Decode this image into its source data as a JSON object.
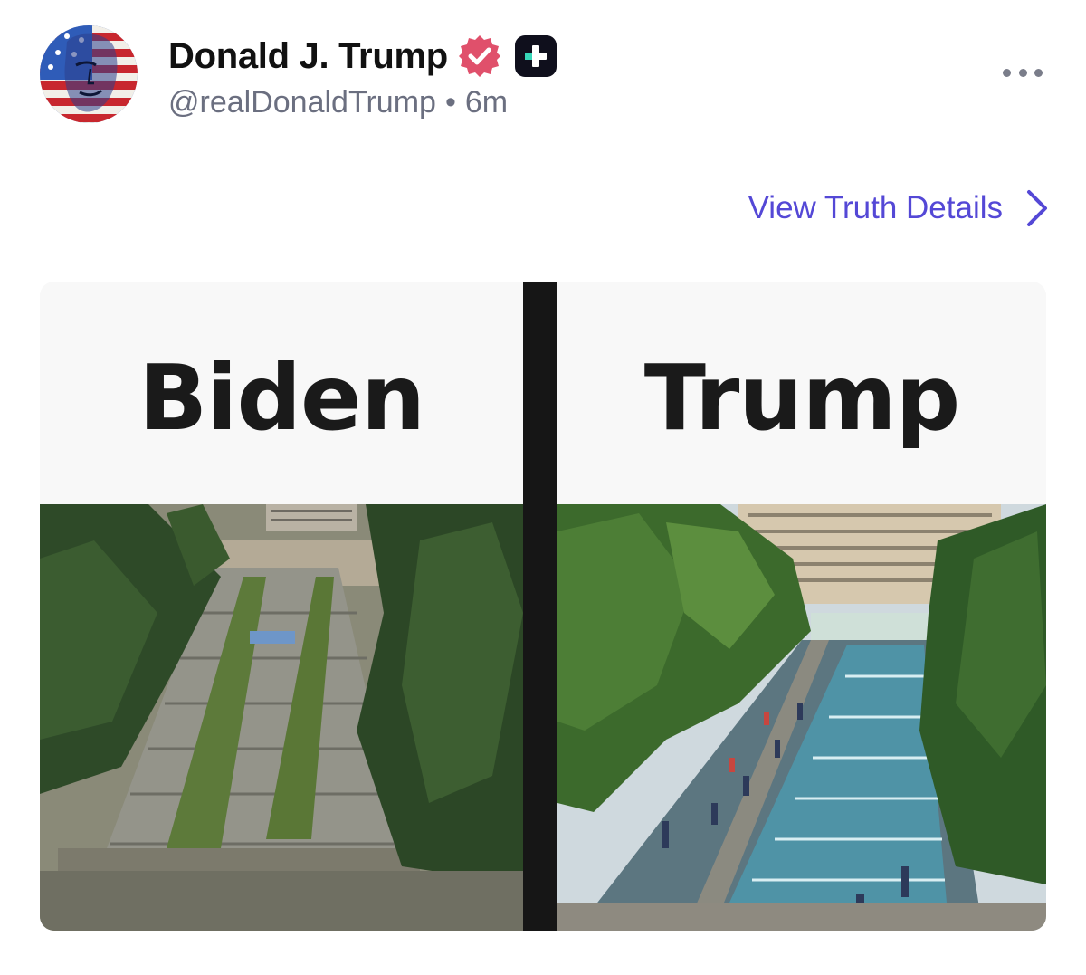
{
  "post": {
    "author": {
      "display_name": "Donald J. Trump",
      "handle": "@realDonaldTrump",
      "separator": "•",
      "time_ago": "6m"
    },
    "icons": {
      "avatar": "flag-portrait-avatar",
      "verified": "verified-badge-icon",
      "plus": "plus-badge-icon",
      "more": "more-options-icon",
      "chevron": "chevron-right-icon"
    },
    "details_link": {
      "label": "View Truth Details"
    },
    "media": {
      "left_caption": "Biden",
      "right_caption": "Trump"
    },
    "colors": {
      "accent": "#5448d6",
      "verified": "#e0506b",
      "secondary_text": "#6b6f80"
    }
  }
}
